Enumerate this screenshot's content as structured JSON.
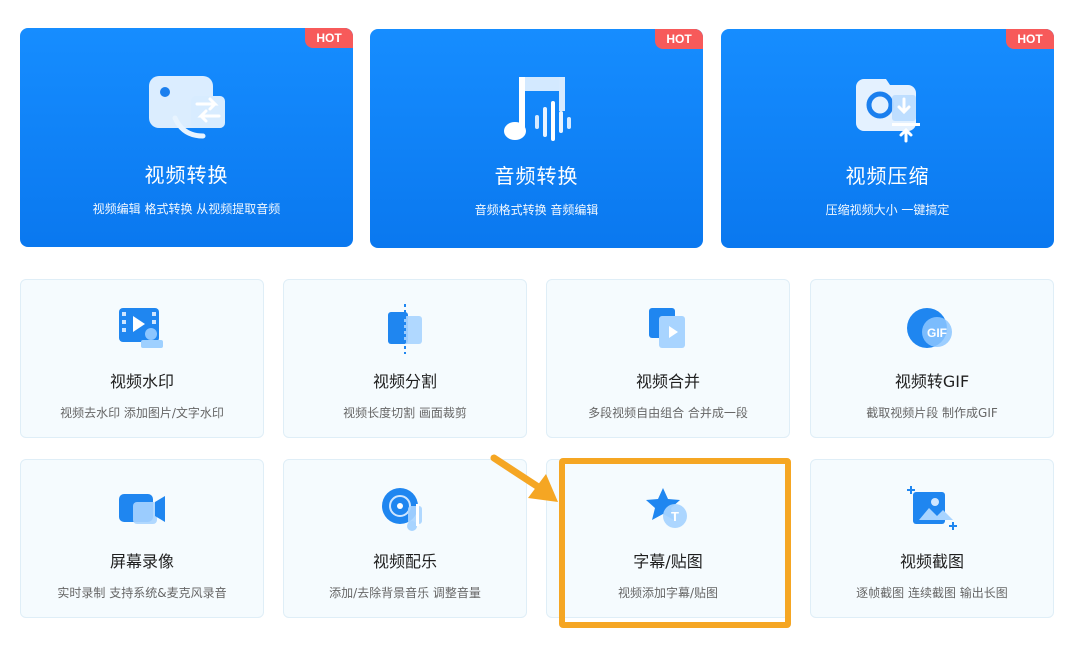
{
  "featured": [
    {
      "badge": "HOT",
      "title": "视频转换",
      "desc": "视频编辑 格式转换 从视频提取音频",
      "icon": "video-convert-icon"
    },
    {
      "badge": "HOT",
      "title": "音频转换",
      "desc": "音频格式转换 音频编辑",
      "icon": "music-note-icon"
    },
    {
      "badge": "HOT",
      "title": "视频压缩",
      "desc": "压缩视频大小 一键搞定",
      "icon": "compress-icon"
    }
  ],
  "tools_row1": [
    {
      "title": "视频水印",
      "desc": "视频去水印 添加图片/文字水印",
      "icon": "watermark-icon"
    },
    {
      "title": "视频分割",
      "desc": "视频长度切割 画面裁剪",
      "icon": "split-icon"
    },
    {
      "title": "视频合并",
      "desc": "多段视频自由组合 合并成一段",
      "icon": "merge-icon"
    },
    {
      "title": "视频转GIF",
      "desc": "截取视频片段 制作成GIF",
      "icon": "gif-icon",
      "icon_text": "GIF"
    }
  ],
  "tools_row2": [
    {
      "title": "屏幕录像",
      "desc": "实时录制 支持系统&麦克风录音",
      "icon": "screen-record-icon"
    },
    {
      "title": "视频配乐",
      "desc": "添加/去除背景音乐 调整音量",
      "icon": "music-disc-icon"
    },
    {
      "title": "字幕/贴图",
      "desc": "视频添加字幕/贴图",
      "icon": "subtitle-star-icon",
      "icon_text": "T"
    },
    {
      "title": "视频截图",
      "desc": "逐帧截图 连续截图 输出长图",
      "icon": "screenshot-icon"
    }
  ],
  "annotation": {
    "color": "#f5a623",
    "target": "字幕/贴图"
  }
}
